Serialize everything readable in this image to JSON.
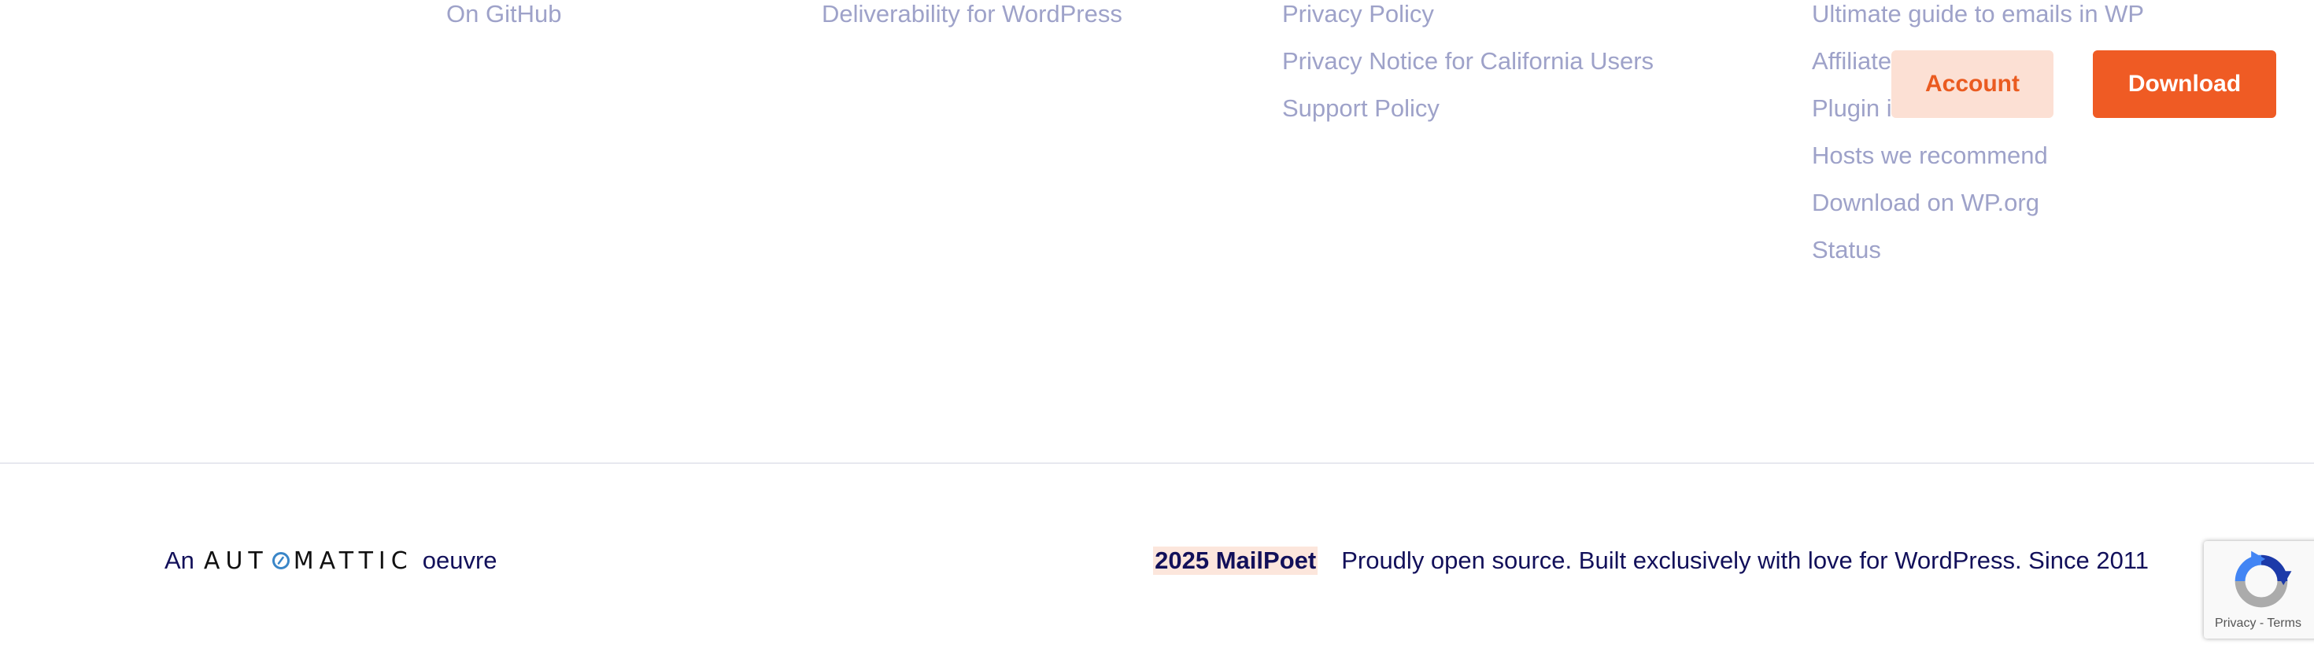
{
  "footer": {
    "columns": [
      {
        "links": [
          "On GitHub"
        ]
      },
      {
        "links": [
          "Deliverability for WordPress"
        ]
      },
      {
        "links": [
          "Privacy Policy",
          "Privacy Notice for California Users",
          "Support Policy"
        ]
      },
      {
        "links": [
          "Ultimate guide to emails in WP",
          "Affiliate",
          "Plugin i",
          "Hosts we recommend",
          "Download on WP.org",
          "Status"
        ]
      }
    ]
  },
  "header_buttons": {
    "account_label": "Account",
    "download_label": "Download"
  },
  "bottom_bar": {
    "prefix": "An",
    "brand_before": "AUT",
    "brand_after": "MATTIC",
    "suffix": "oeuvre",
    "copyright": "2025 MailPoet",
    "tagline": "Proudly open source. Built exclusively with love for WordPress. Since 2011"
  },
  "recaptcha": {
    "terms": "Privacy - Terms"
  },
  "colors": {
    "link": "#9ea2c9",
    "accent": "#ef5b24",
    "accent_light": "#fce0d4",
    "navy": "#12105a",
    "wordmark_o": "#3a86c8"
  },
  "icons": [
    "automattic-o-icon",
    "recaptcha-logo-icon"
  ]
}
